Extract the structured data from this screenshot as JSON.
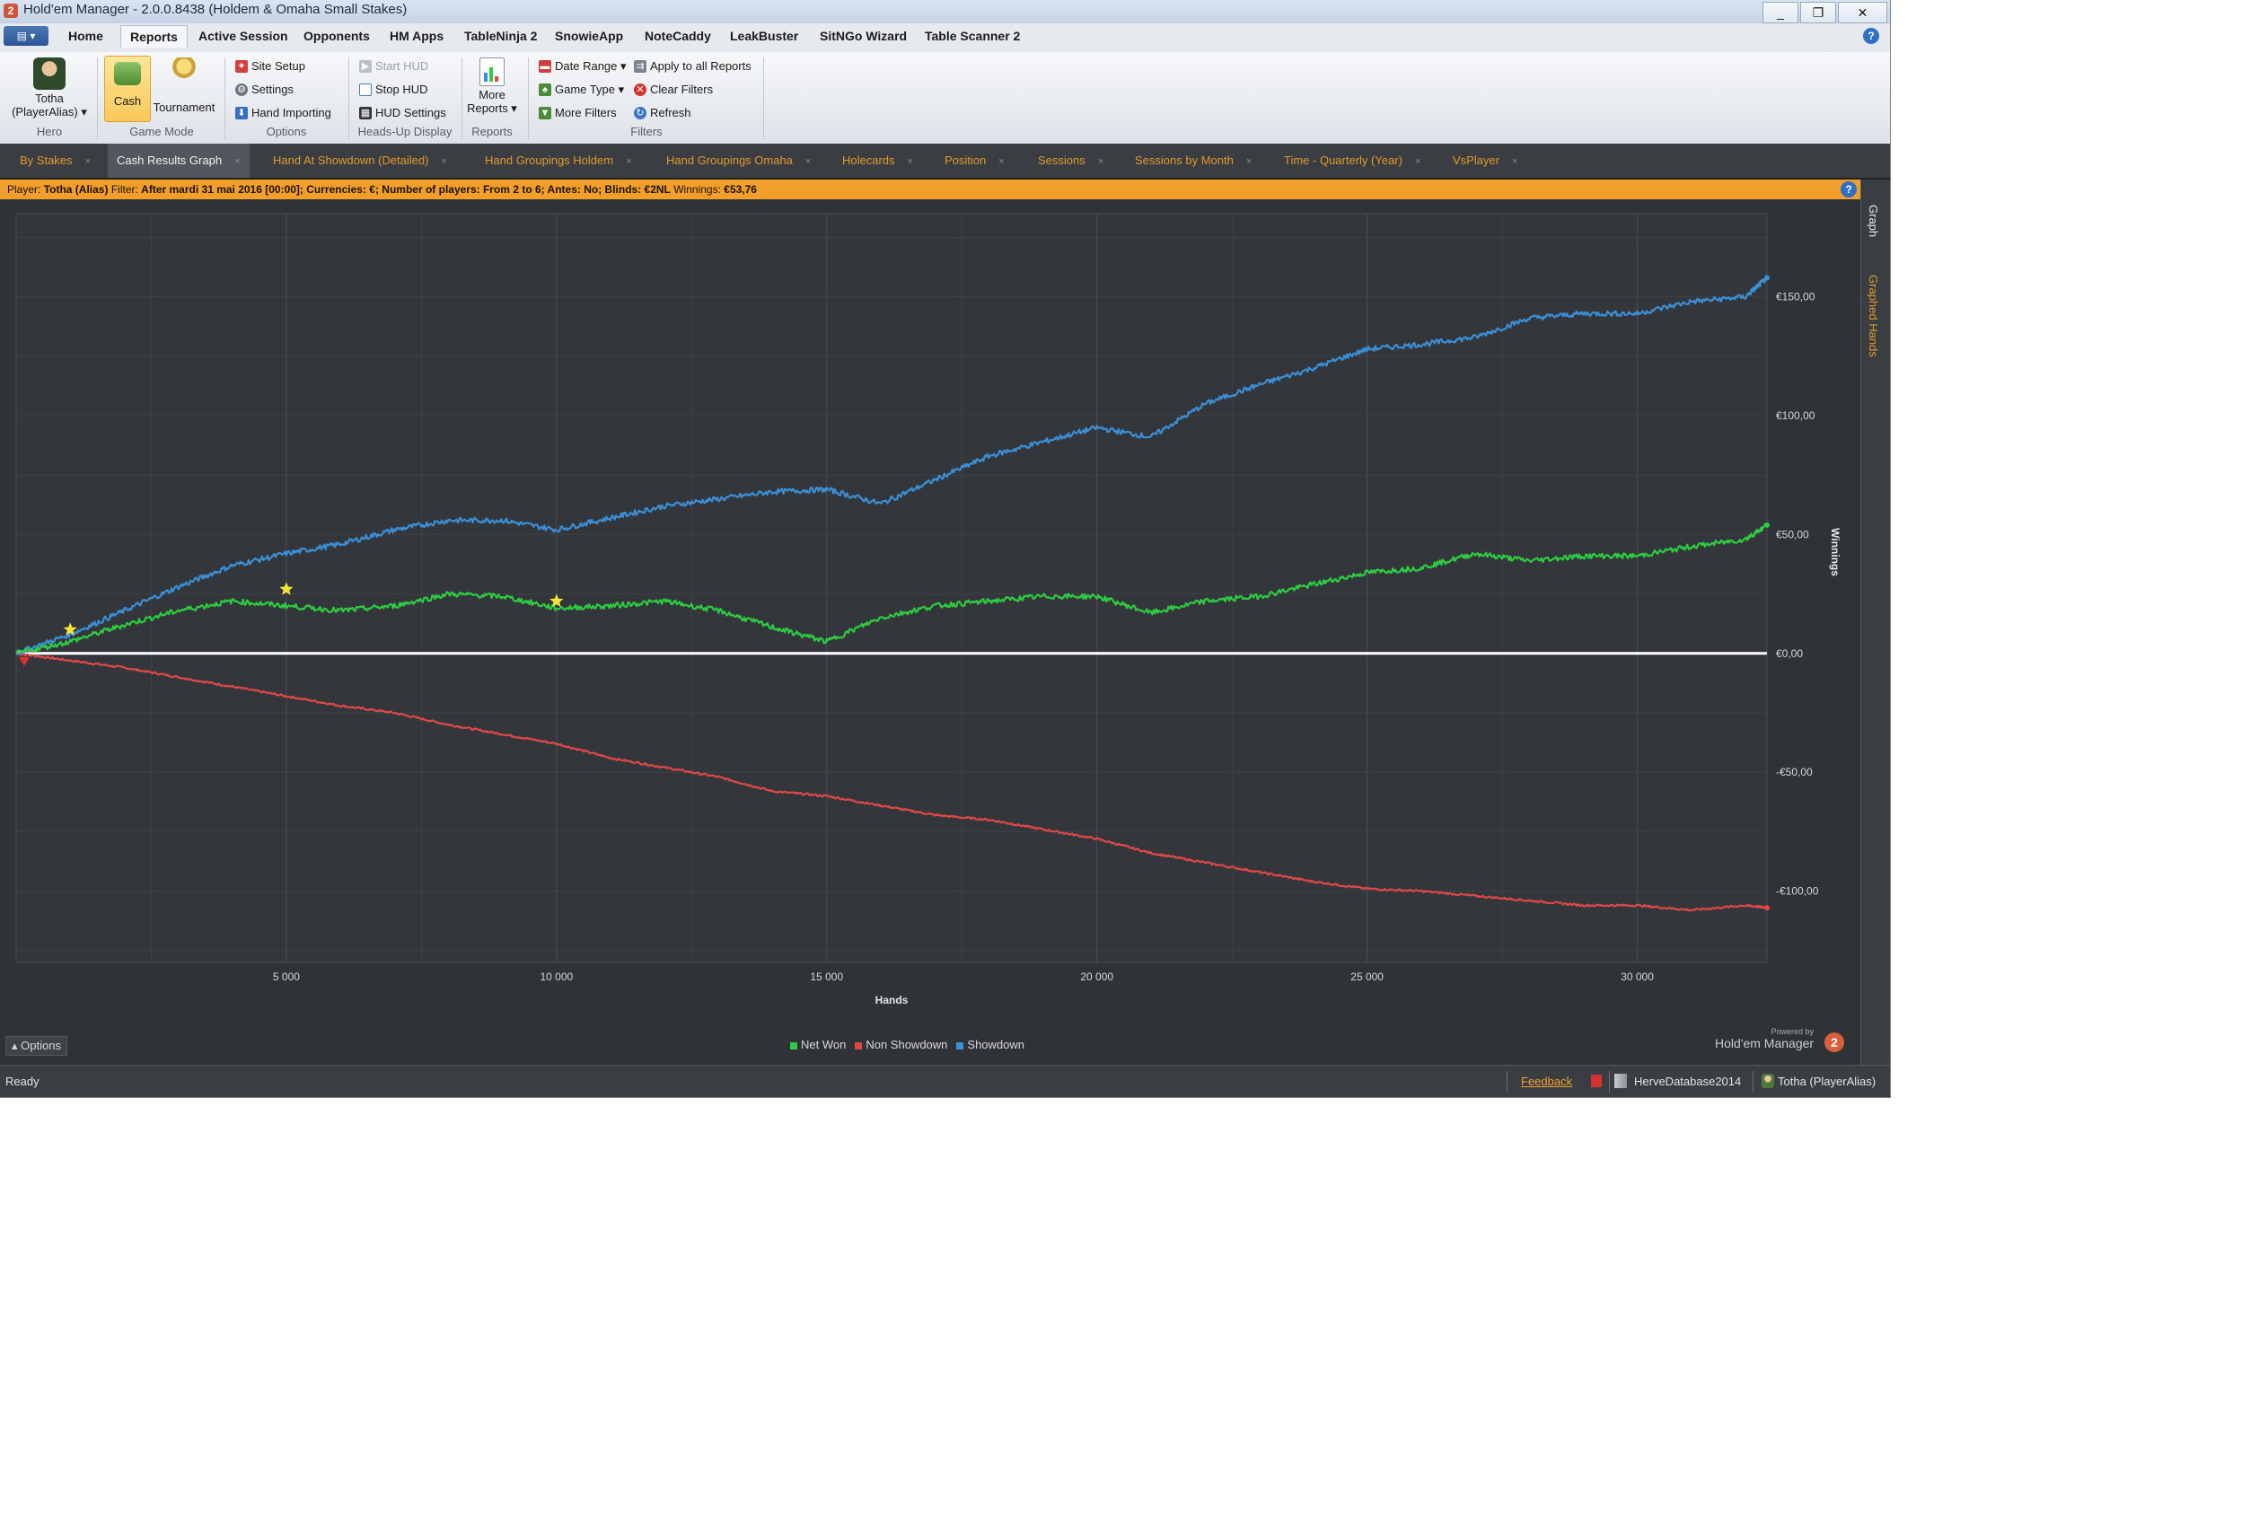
{
  "window": {
    "title": "Hold'em Manager - 2.0.0.8438 (Holdem & Omaha Small Stakes)",
    "app_icon": "2"
  },
  "window_controls": {
    "minimize": "_",
    "restore": "❐",
    "close": "✕"
  },
  "ribbon_tabs": [
    "Home",
    "Reports",
    "Active Session",
    "Opponents",
    "HM Apps",
    "TableNinja 2",
    "SnowieApp",
    "NoteCaddy",
    "LeakBuster",
    "SitNGo Wizard",
    "Table Scanner 2"
  ],
  "ribbon_active_tab": "Reports",
  "ribbon": {
    "hero": {
      "label_line1": "Totha",
      "label_line2": "(PlayerAlias) ▾",
      "group": "Hero"
    },
    "game_mode": {
      "cash": "Cash",
      "tournament": "Tournament",
      "group": "Game Mode"
    },
    "options": {
      "site_setup": "Site Setup",
      "settings": "Settings",
      "hand_importing": "Hand Importing",
      "group": "Options"
    },
    "hud": {
      "start": "Start HUD",
      "stop": "Stop HUD",
      "settings": "HUD Settings",
      "group": "Heads-Up Display"
    },
    "reports": {
      "more_line1": "More",
      "more_line2": "Reports ▾",
      "group": "Reports"
    },
    "filters": {
      "date_range": "Date Range ▾",
      "game_type": "Game Type ▾",
      "more_filters": "More Filters",
      "apply_all": "Apply to all Reports",
      "clear": "Clear Filters",
      "refresh": "Refresh",
      "group": "Filters"
    }
  },
  "report_tabs": [
    "By Stakes",
    "Cash Results Graph",
    "Hand At Showdown (Detailed)",
    "Hand Groupings Holdem",
    "Hand Groupings Omaha",
    "Holecards",
    "Position",
    "Sessions",
    "Sessions by Month",
    "Time - Quarterly (Year)",
    "VsPlayer"
  ],
  "report_tab_close": "×",
  "active_report_tab": "Cash Results Graph",
  "filter_bar": {
    "player_label": "Player:",
    "player": "Totha (Alias)",
    "filter_label": "Filter:",
    "filter": "After mardi 31 mai 2016 [00:00]; Currencies: €; Number of players: From 2 to 6; Antes: No; Blinds: €2NL",
    "winnings_label": "Winnings:",
    "winnings": "€53,76",
    "help": "?"
  },
  "side_tabs": {
    "graph": "Graph",
    "graphed_hands": "Graphed Hands"
  },
  "bottom": {
    "options": "Options",
    "powered_by": "Powered by",
    "powered_name": "Hold'em Manager",
    "logo": "2"
  },
  "status_bar": {
    "status": "Ready",
    "feedback": "Feedback",
    "database": "HerveDatabase2014",
    "player": "Totha (PlayerAlias)"
  },
  "colors": {
    "net_won": "#2ecc40",
    "non_showdown": "#e04848",
    "showdown": "#3b8fd6",
    "accent": "#f29e2b"
  },
  "chart_data": {
    "type": "line",
    "xlabel": "Hands",
    "ylabel": "Winnings",
    "xlim": [
      0,
      32400
    ],
    "ylim": [
      -130,
      185
    ],
    "x_ticks": [
      5000,
      10000,
      15000,
      20000,
      25000,
      30000
    ],
    "x_tick_labels": [
      "5 000",
      "10 000",
      "15 000",
      "20 000",
      "25 000",
      "30 000"
    ],
    "y_ticks": [
      150,
      100,
      50,
      0,
      -50,
      -100
    ],
    "y_tick_labels": [
      "€150,00",
      "€100,00",
      "€50,00",
      "€0,00",
      "-€50,00",
      "-€100,00"
    ],
    "legend": [
      "Net Won",
      "Non Showdown",
      "Showdown"
    ],
    "legend_position": "bottom-center",
    "grid": true,
    "x": [
      0,
      1000,
      2000,
      3000,
      4000,
      5000,
      6000,
      7000,
      8000,
      9000,
      10000,
      11000,
      12000,
      13000,
      14000,
      15000,
      16000,
      17000,
      18000,
      19000,
      20000,
      21000,
      22000,
      23000,
      24000,
      25000,
      26000,
      27000,
      28000,
      29000,
      30000,
      31000,
      32000,
      32400
    ],
    "series": [
      {
        "name": "Showdown",
        "color": "#3b8fd6",
        "values": [
          0,
          8,
          18,
          28,
          37,
          42,
          46,
          52,
          56,
          56,
          52,
          57,
          62,
          65,
          68,
          69,
          63,
          73,
          83,
          89,
          95,
          91,
          105,
          113,
          120,
          128,
          130,
          133,
          141,
          143,
          143,
          148,
          150,
          158
        ]
      },
      {
        "name": "Net Won",
        "color": "#2ecc40",
        "values": [
          0,
          5,
          12,
          18,
          22,
          20,
          18,
          20,
          25,
          24,
          19,
          20,
          22,
          18,
          11,
          5,
          15,
          20,
          22,
          24,
          24,
          17,
          22,
          24,
          29,
          34,
          36,
          42,
          39,
          41,
          41,
          45,
          48,
          54
        ]
      },
      {
        "name": "Non Showdown",
        "color": "#e04848",
        "values": [
          0,
          -3,
          -6,
          -10,
          -14,
          -18,
          -22,
          -25,
          -30,
          -34,
          -38,
          -44,
          -48,
          -52,
          -58,
          -60,
          -64,
          -68,
          -70,
          -74,
          -78,
          -84,
          -88,
          -92,
          -96,
          -99,
          -100,
          -102,
          -104,
          -106,
          -106,
          -108,
          -106,
          -107
        ]
      }
    ],
    "markers": [
      {
        "type": "star",
        "x": 1000,
        "y": 10
      },
      {
        "type": "star",
        "x": 5000,
        "y": 27
      },
      {
        "type": "star",
        "x": 10000,
        "y": 22
      },
      {
        "type": "triangle-down",
        "x": 150,
        "y": -3
      }
    ]
  }
}
